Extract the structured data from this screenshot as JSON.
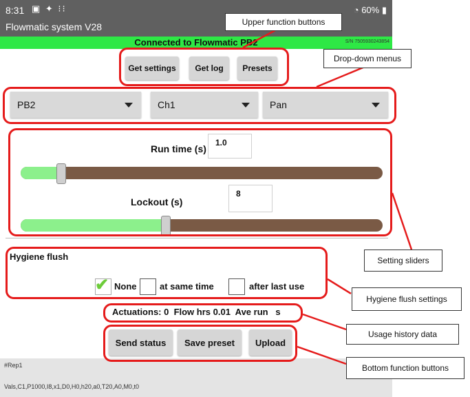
{
  "status_bar": {
    "time": "8:31",
    "icons_text": "▣ ✦ ⁝⁝",
    "battery": "60%"
  },
  "app_title": "Flowmatic system V28",
  "connection": {
    "status": "Connected to Flowmatic PB2",
    "serial": "S/N 7505930243854"
  },
  "top_buttons": {
    "get_settings": "Get settings",
    "get_log": "Get log",
    "presets": "Presets"
  },
  "dropdowns": [
    {
      "value": "PB2"
    },
    {
      "value": "Ch1"
    },
    {
      "value": "Pan"
    }
  ],
  "run_time": {
    "label": "Run time (s)",
    "value": "1.0",
    "slider_fraction": 0.11
  },
  "lockout": {
    "label": "Lockout (s)",
    "value": "8",
    "slider_fraction": 0.4
  },
  "hygiene": {
    "title": "Hygiene flush",
    "options": [
      {
        "label": "None",
        "checked": true
      },
      {
        "label": "at same time",
        "checked": false
      },
      {
        "label": "after last use",
        "checked": false
      }
    ]
  },
  "usage": {
    "text": "Actuations: 0  Flow hrs 0.01  Ave run   s"
  },
  "bottom_buttons": {
    "send_status": "Send status",
    "save_preset": "Save preset",
    "upload": "Upload"
  },
  "log": {
    "line1": "#Rep1",
    "line2": "Vals,C1,P1000,I8,x1,D0,H0,h20,a0,T20,A0,M0,t0"
  },
  "callouts": {
    "upper": "Upper function buttons",
    "dropdown": "Drop-down menus",
    "sliders": "Setting sliders",
    "hygiene": "Hygiene flush settings",
    "usage": "Usage history data",
    "bottom": "Bottom function buttons"
  },
  "colors": {
    "highlight": "#e51b1b",
    "connected_green": "#2ee845",
    "slider_fill": "#8cf08c",
    "slider_track": "#7a5a45",
    "bar_gray": "#606060"
  }
}
